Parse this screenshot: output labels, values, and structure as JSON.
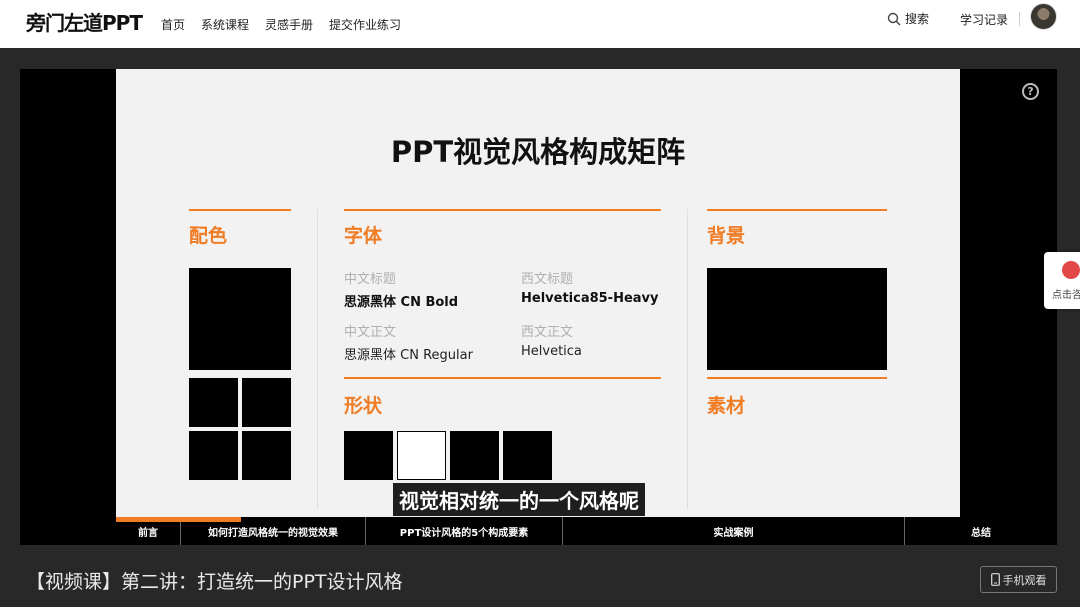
{
  "header": {
    "logo": "旁门左道PPT",
    "nav": [
      "首页",
      "系统课程",
      "灵感手册",
      "提交作业练习"
    ],
    "search_label": "搜索",
    "history_label": "学习记录"
  },
  "slide": {
    "title": "PPT视觉风格构成矩阵",
    "sections": {
      "color": "配色",
      "font": "字体",
      "background": "背景",
      "shape": "形状",
      "material": "素材"
    },
    "font_table": {
      "cn_title_label": "中文标题",
      "cn_title_value": "思源黑体 CN Bold",
      "en_title_label": "西文标题",
      "en_title_value": "Helvetica85-Heavy",
      "cn_body_label": "中文正文",
      "cn_body_value": "思源黑体 CN Regular",
      "en_body_label": "西文正文",
      "en_body_value": "Helvetica"
    }
  },
  "video": {
    "subtitle": "视觉相对统一的一个风格呢",
    "chapters": [
      "前言",
      "如何打造风格统一的视觉效果",
      "PPT设计风格的5个构成要素",
      "实战案例",
      "总结"
    ],
    "help_glyph": "?",
    "accent": "#f07c24"
  },
  "consult": {
    "label": "点击咨"
  },
  "page": {
    "title": "【视频课】第二讲：打造统一的PPT设计风格",
    "mobile_button": "手机观看"
  }
}
